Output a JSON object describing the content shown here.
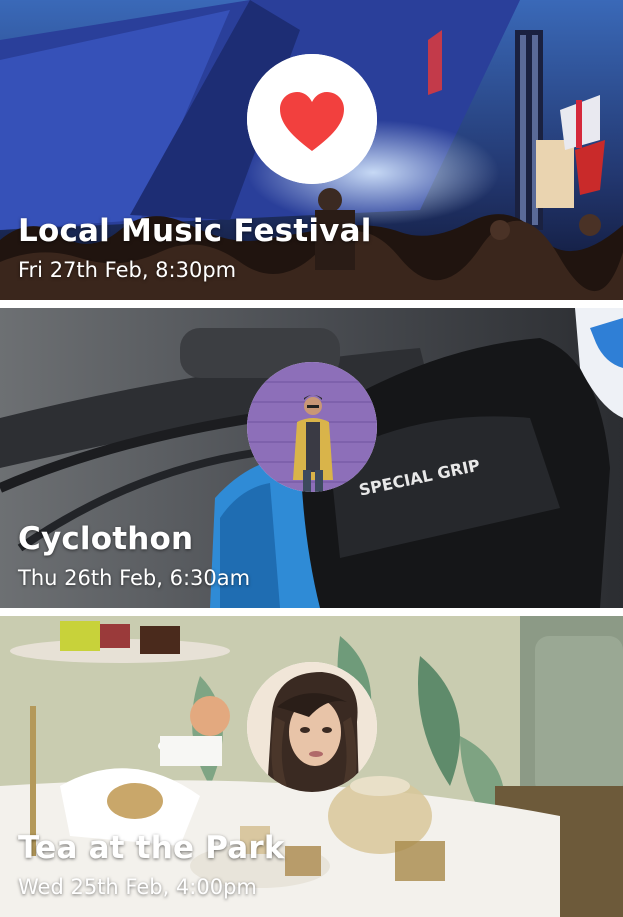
{
  "events": [
    {
      "title": "Local Music Festival",
      "date": "Fri 27th Feb, 8:30pm",
      "badge_icon": "heart-icon",
      "badge_color": "#f2403e"
    },
    {
      "title": "Cyclothon",
      "date": "Thu 26th Feb, 6:30am",
      "badge_icon": "avatar-man"
    },
    {
      "title": "Tea at the Park",
      "date": "Wed 25th Feb, 4:00pm",
      "badge_icon": "avatar-woman"
    }
  ]
}
